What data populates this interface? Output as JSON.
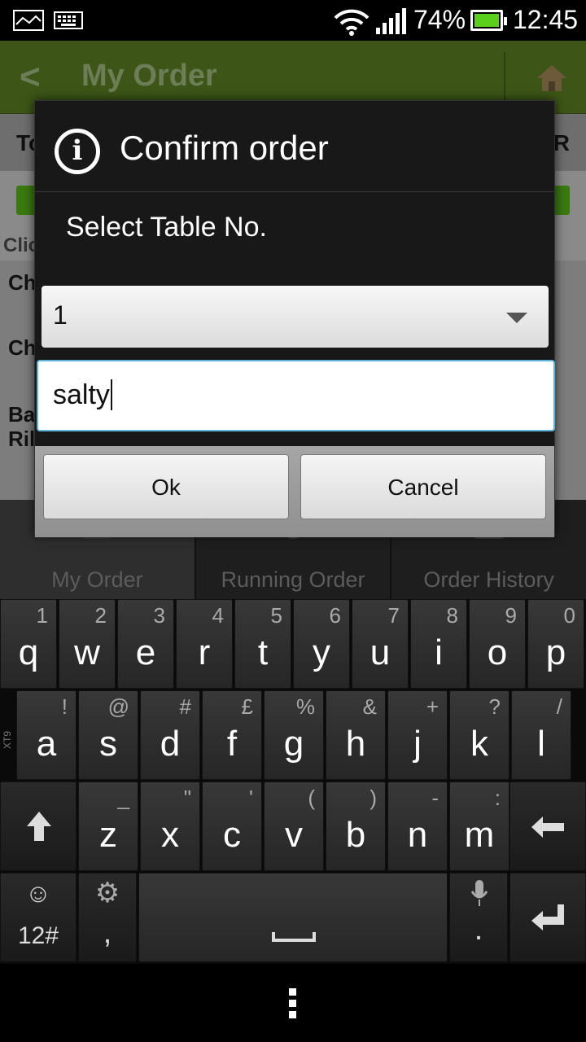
{
  "status_bar": {
    "battery_percent": "74%",
    "time": "12:45"
  },
  "app": {
    "title": "My Order",
    "subheader_left": "To",
    "subheader_right": "R",
    "hint_text": "Clic",
    "list_items": [
      "Ch",
      "Ch",
      "Ba",
      "Ril"
    ],
    "tabs": [
      {
        "label": "My Order"
      },
      {
        "label": "Running Order"
      },
      {
        "label": "Order History"
      }
    ]
  },
  "dialog": {
    "title": "Confirm order",
    "message": "Select Table No.",
    "table_select_value": "1",
    "note_input_value": "salty",
    "ok_label": "Ok",
    "cancel_label": "Cancel"
  },
  "keyboard": {
    "row1": [
      {
        "k": "q",
        "s": "1"
      },
      {
        "k": "w",
        "s": "2"
      },
      {
        "k": "e",
        "s": "3"
      },
      {
        "k": "r",
        "s": "4"
      },
      {
        "k": "t",
        "s": "5"
      },
      {
        "k": "y",
        "s": "6"
      },
      {
        "k": "u",
        "s": "7"
      },
      {
        "k": "i",
        "s": "8"
      },
      {
        "k": "o",
        "s": "9"
      },
      {
        "k": "p",
        "s": "0"
      }
    ],
    "row2": [
      {
        "k": "a",
        "s": "!"
      },
      {
        "k": "s",
        "s": "@"
      },
      {
        "k": "d",
        "s": "#"
      },
      {
        "k": "f",
        "s": "£"
      },
      {
        "k": "g",
        "s": "%"
      },
      {
        "k": "h",
        "s": "&"
      },
      {
        "k": "j",
        "s": "+"
      },
      {
        "k": "k",
        "s": "?"
      },
      {
        "k": "l",
        "s": "/"
      }
    ],
    "row3": [
      {
        "k": "z",
        "s": "_"
      },
      {
        "k": "x",
        "s": "\""
      },
      {
        "k": "c",
        "s": "'"
      },
      {
        "k": "v",
        "s": "("
      },
      {
        "k": "b",
        "s": ")"
      },
      {
        "k": "n",
        "s": "-"
      },
      {
        "k": "m",
        "s": ":"
      }
    ],
    "xt9_label": "XT9",
    "symbols_label": "12#",
    "comma_label": ",",
    "period_label": "."
  }
}
